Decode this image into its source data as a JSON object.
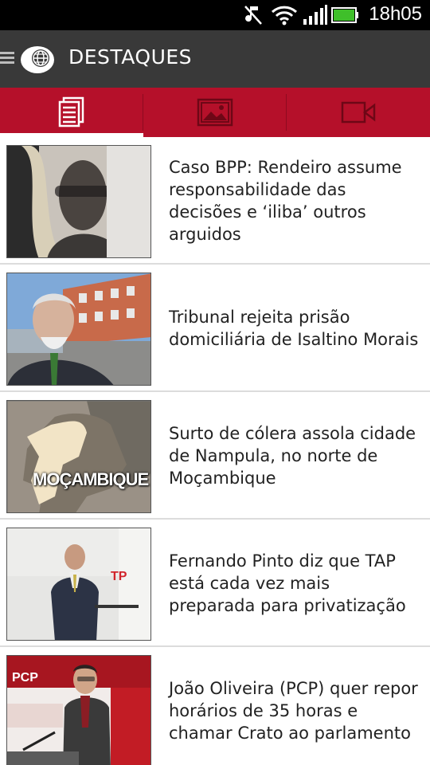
{
  "status_bar": {
    "time": "18h05",
    "icons": [
      "music-muted-icon",
      "wifi-icon",
      "signal-icon",
      "battery-icon"
    ]
  },
  "app_bar": {
    "title": "DESTAQUES",
    "menu_icon": "menu-icon",
    "logo_icon": "globe-logo-icon"
  },
  "tabs": [
    {
      "icon": "news-icon",
      "selected": true
    },
    {
      "icon": "photo-icon",
      "selected": false
    },
    {
      "icon": "video-icon",
      "selected": false
    }
  ],
  "colors": {
    "tab_bar": "#b5102a",
    "app_bar": "#393939",
    "status_bar": "#000000"
  },
  "articles": [
    {
      "headline": "Caso BPP: Rendeiro assume responsabilidade das decisões e ‘iliba’ outros arguidos"
    },
    {
      "headline": "Tribunal rejeita prisão domiciliária de Isaltino Morais"
    },
    {
      "headline": "Surto de cólera assola cidade de Nampula, no norte de Moçambique",
      "thumb_caption": "MOÇAMBIQUE"
    },
    {
      "headline": "Fernando Pinto diz que TAP está cada vez mais preparada para privatização"
    },
    {
      "headline": "João Oliveira (PCP) quer repor horários de 35 horas e chamar Crato ao parlamento"
    }
  ]
}
